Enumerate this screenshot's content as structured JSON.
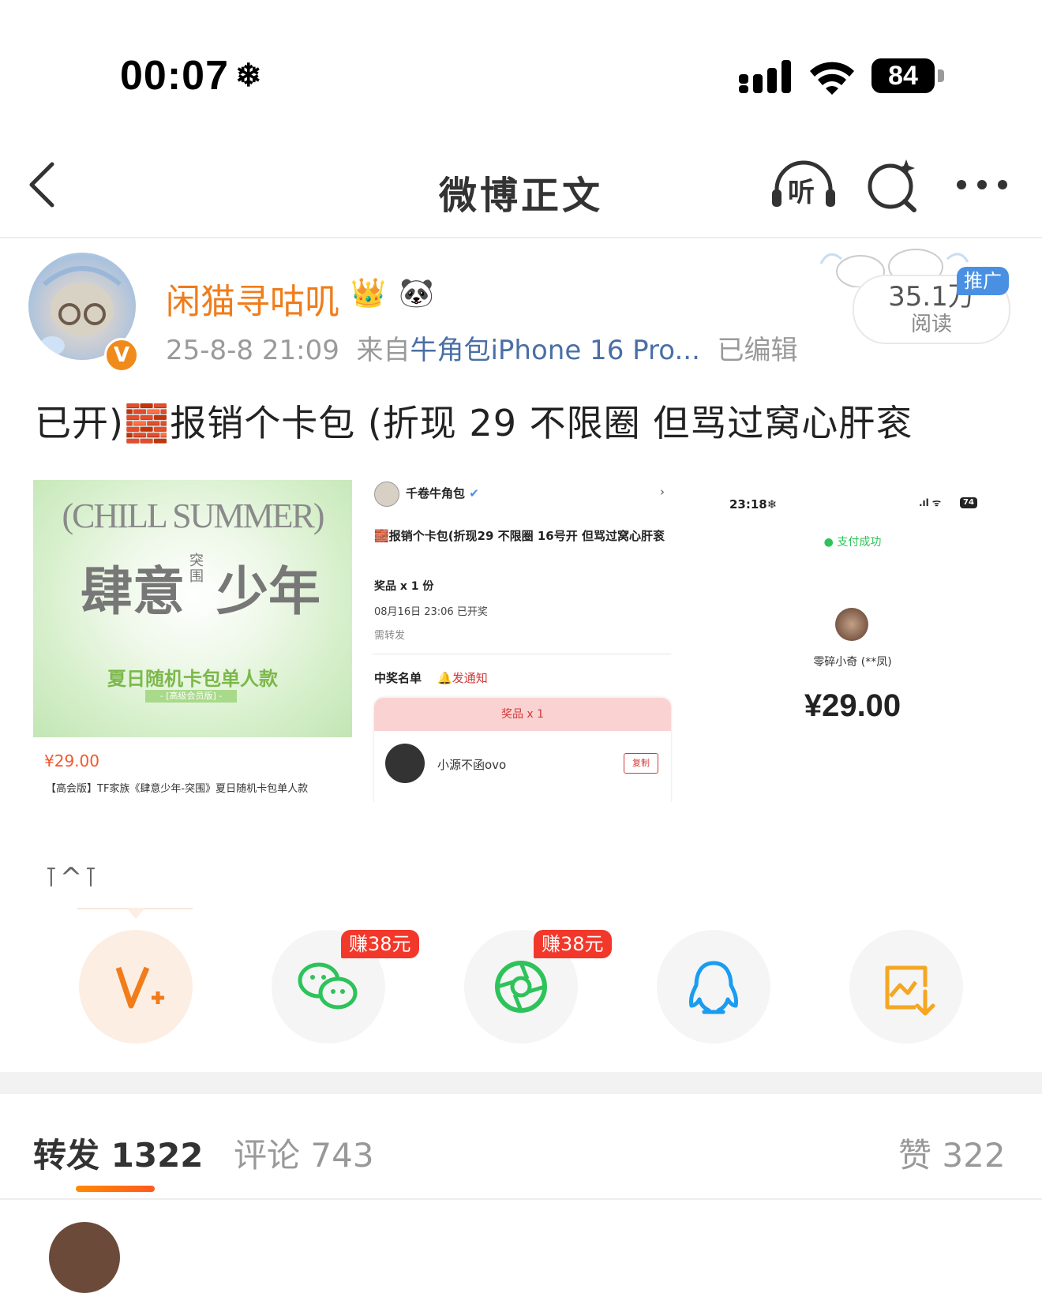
{
  "status_bar": {
    "time": "00:07",
    "time_icon": "snowflake-icon",
    "battery": "84",
    "signal_icon": "signal-icon",
    "wifi_icon": "wifi-icon"
  },
  "nav": {
    "title": "微博正文",
    "back_icon": "chevron-left-icon",
    "listen_label": "听",
    "search_icon": "ai-search-icon",
    "more_icon": "more-dots-icon"
  },
  "post": {
    "author": "闲猫寻咕叽",
    "verified_badge": "V",
    "meta_time": "25-8-8 21:09",
    "meta_from": "来自",
    "meta_source": "牛角包iPhone 16 Pro...",
    "meta_edited": "已编辑",
    "reads_count": "35.1万",
    "reads_label": "阅读",
    "promo_tag": "推广",
    "text_prefix": "已开)",
    "text_body": "报销个卡包 (折现 29 不限圈 但骂过窝心肝衮",
    "signature": "⊺^⊺"
  },
  "images": {
    "product": {
      "title_en": "(CHILL SUMMER)",
      "title_cn_left": "肆意",
      "title_cn_mid": "突围",
      "title_cn_right": "少年",
      "subtitle": "夏日随机卡包单人款",
      "edition": "- [高级会员版] -",
      "price": "¥29.00",
      "caption": "【高会版】TF家族《肆意少年-突围》夏日随机卡包单人款"
    },
    "lottery": {
      "account": "千卷牛角包",
      "post_text": "报销个卡包(折现29 不限圈 16号开 但骂过窝心肝衮",
      "prize": "奖品  x 1 份",
      "draw_time": "08月16日 23:06 已开奖",
      "requirement": "需转发",
      "winners_label": "中奖名单",
      "notify_label": "发通知",
      "prize_header": "奖品 x 1",
      "winner_name": "小源不函ovo",
      "copy_label": "复制"
    },
    "payment": {
      "time": "23:18",
      "battery": "74",
      "status": "支付成功",
      "payee": "零碎小奇 (**凤)",
      "amount": "¥29.00"
    }
  },
  "share": {
    "items": [
      {
        "name": "weibo-repost",
        "icon": "weibo-repost-icon",
        "earn": ""
      },
      {
        "name": "wechat",
        "icon": "wechat-icon",
        "earn": "赚38元"
      },
      {
        "name": "moments",
        "icon": "moments-icon",
        "earn": "赚38元"
      },
      {
        "name": "qq",
        "icon": "qq-icon",
        "earn": ""
      },
      {
        "name": "save-image",
        "icon": "save-image-icon",
        "earn": ""
      }
    ]
  },
  "tabs": {
    "repost_label": "转发",
    "repost_count": "1322",
    "comment_label": "评论",
    "comment_count": "743",
    "like_label": "赞",
    "like_count": "322"
  },
  "colors": {
    "accent": "#f07c1a",
    "link": "#4a6fa5",
    "earn": "#f2382a",
    "wechat_green": "#2ec35a",
    "qq_blue": "#1a9cf0"
  }
}
